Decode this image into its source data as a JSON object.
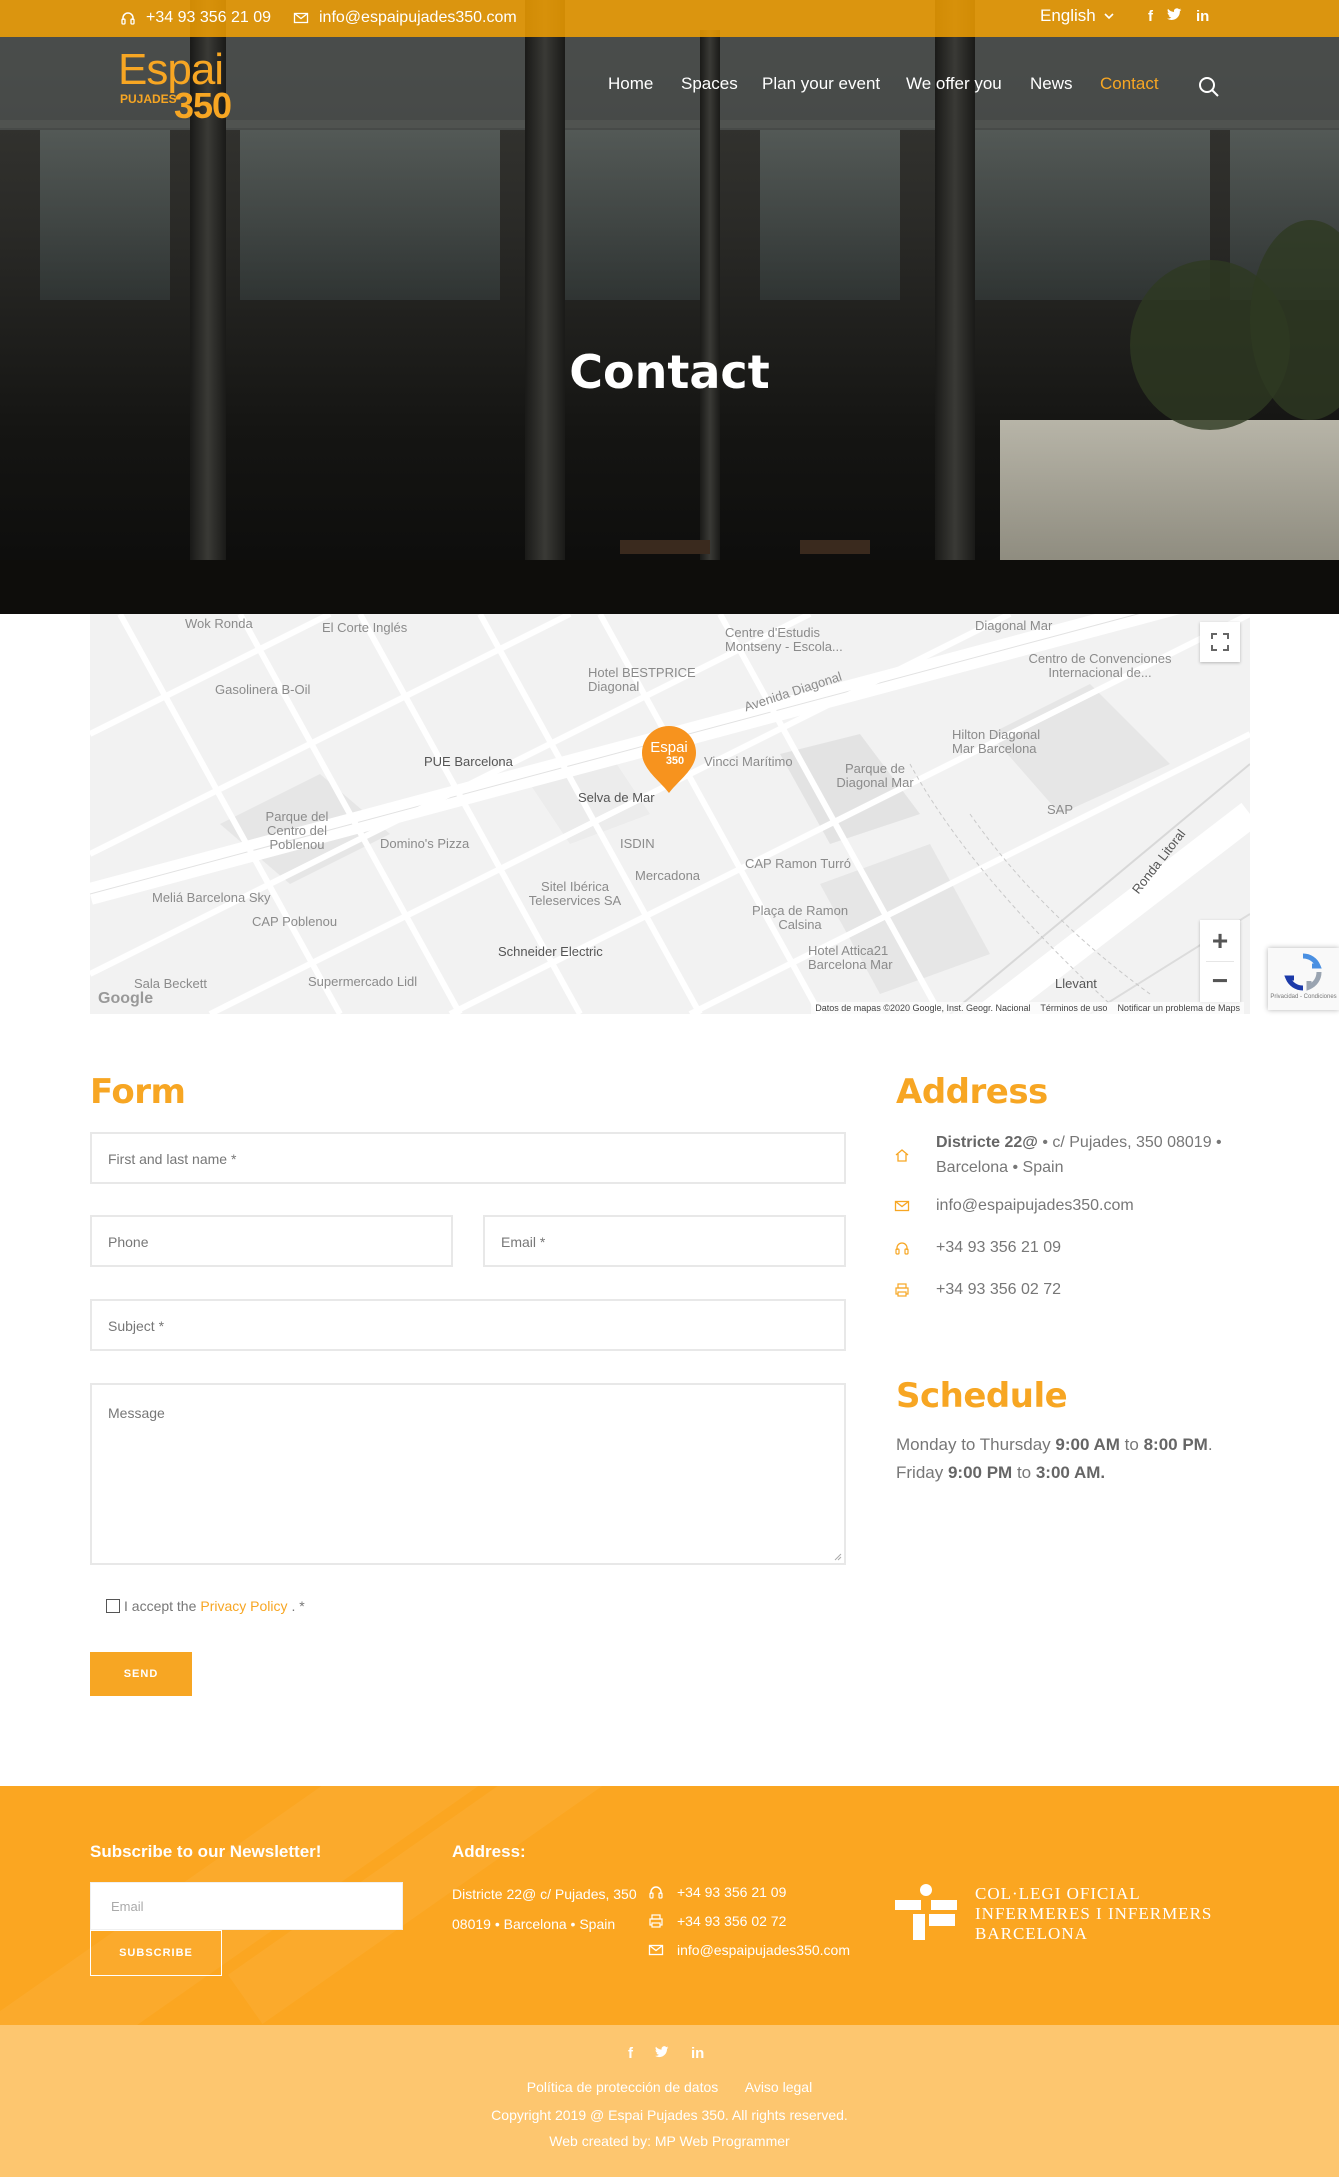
{
  "topbar": {
    "phone": "+34 93 356 21 09",
    "email": "info@espaipujades350.com",
    "language": "English",
    "social": [
      "facebook-icon",
      "twitter-icon",
      "linkedin-icon"
    ]
  },
  "logo": {
    "word1": "Espai",
    "word2": "PUJADES",
    "word3": "350"
  },
  "nav": {
    "items": [
      {
        "label": "Home"
      },
      {
        "label": "Spaces"
      },
      {
        "label": "Plan your event"
      },
      {
        "label": "We offer you"
      },
      {
        "label": "News"
      },
      {
        "label": "Contact"
      }
    ],
    "active": "Contact"
  },
  "hero": {
    "title": "Contact"
  },
  "map": {
    "marker": {
      "line1": "Espai",
      "line2": "350",
      "label": "Selva de Mar"
    },
    "places": [
      "Wok Ronda",
      "El Corte Inglés",
      "Centre d'Estudis Montseny - Escola...",
      "Diagonal Mar",
      "Centro de Convenciones Internacional de...",
      "Hotel BESTPRICE Diagonal",
      "Gasolinera B-Oil",
      "Avenida Diagonal",
      "PUE Barcelona",
      "Vincci Marítimo",
      "Hilton Diagonal Mar Barcelona",
      "Parque de Diagonal Mar",
      "Parque del Centro del Poblenou",
      "Domino's Pizza",
      "ISDIN",
      "SAP",
      "Sitel Ibérica Teleservices SA",
      "Mercadona",
      "CAP Ramon Turró",
      "Ronda Litoral",
      "Meliá Barcelona Sky",
      "CAP Poblenou",
      "Plaça de Ramon Calsina",
      "Schneider Electric",
      "Hotel Attica21 Barcelona Mar",
      "Sala Beckett",
      "Supermercado Lidl",
      "Llevant"
    ],
    "attribution": {
      "data": "Datos de mapas ©2020 Google, Inst. Geogr. Nacional",
      "terms": "Términos de uso",
      "report": "Notificar un problema de Maps",
      "google": "Google"
    },
    "recaptcha": "Privacidad - Condiciones"
  },
  "form": {
    "title": "Form",
    "name_placeholder": "First and last name *",
    "phone_placeholder": "Phone",
    "email_placeholder": "Email *",
    "subject_placeholder": "Subject *",
    "message_placeholder": "Message",
    "privacy_prefix": "I accept the",
    "privacy_link": "Privacy Policy",
    "privacy_suffix": ". *",
    "send_label": "SEND"
  },
  "address": {
    "title": "Address",
    "street_bold": "Districte 22@",
    "street_rest": " • c/ Pujades, 350 08019 •",
    "city": "Barcelona • Spain",
    "email": "info@espaipujades350.com",
    "phone": "+34 93 356 21 09",
    "fax": "+34 93 356 02 72"
  },
  "schedule": {
    "title": "Schedule",
    "line1_a": "Monday to Thursday ",
    "line1_b": "9:00 AM",
    "line1_c": " to ",
    "line1_d": "8:00 PM",
    "line1_e": ".",
    "line2_a": "Friday ",
    "line2_b": "9:00 PM",
    "line2_c": " to ",
    "line2_d": "3:00 AM."
  },
  "footer": {
    "newsletter_title": "Subscribe to our Newsletter!",
    "email_placeholder": "Email",
    "subscribe_label": "SUBSCRIBE",
    "address_title": "Address:",
    "addr_line1": "Districte 22@   c/ Pujades, 350",
    "addr_line2": "08019 • Barcelona • Spain",
    "phone": "+34 93 356 21 09",
    "fax": "+34 93 356 02 72",
    "email": "info@espaipujades350.com",
    "partner_line1": "COL·LEGI OFICIAL",
    "partner_line2": "INFERMERES I INFERMERS",
    "partner_line3": "BARCELONA"
  },
  "subfooter": {
    "links": [
      "Política de protección de datos",
      "Aviso legal"
    ],
    "copyright": "Copyright 2019 @ Espai Pujades 350. All rights reserved.",
    "credit": "Web created by: MP Web Programmer"
  },
  "colors": {
    "accent": "#f7a623",
    "footer": "#fba621",
    "subfooter": "#fdc66f"
  }
}
